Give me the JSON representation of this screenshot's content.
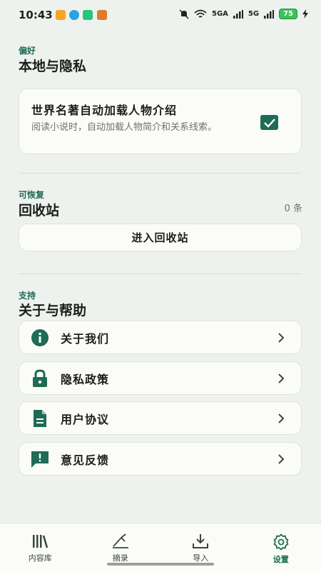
{
  "status_bar": {
    "time": "10:43",
    "battery": "75",
    "signal_1": "5GA",
    "signal_2": "5G"
  },
  "preferences": {
    "kicker": "偏好",
    "title": "本地与隐私",
    "option_title": "世界名著自动加载人物介绍",
    "option_desc": "阅读小说时，自动加载人物简介和关系线索。",
    "checked": true
  },
  "recycle": {
    "kicker": "可恢复",
    "title": "回收站",
    "count": "0 条",
    "button_label": "进入回收站"
  },
  "support": {
    "kicker": "支持",
    "title": "关于与帮助",
    "items": [
      {
        "label": "关于我们",
        "icon": "info-icon"
      },
      {
        "label": "隐私政策",
        "icon": "lock-icon"
      },
      {
        "label": "用户协议",
        "icon": "document-icon"
      },
      {
        "label": "意见反馈",
        "icon": "feedback-icon"
      }
    ]
  },
  "nav": {
    "items": [
      {
        "label": "内容库",
        "icon": "library-icon"
      },
      {
        "label": "摘录",
        "icon": "highlight-icon"
      },
      {
        "label": "导入",
        "icon": "download-icon"
      },
      {
        "label": "设置",
        "icon": "settings-icon",
        "active": true
      }
    ]
  },
  "colors": {
    "accent": "#1f6b55",
    "background": "#eef2ee",
    "card": "#fbfcf8"
  }
}
